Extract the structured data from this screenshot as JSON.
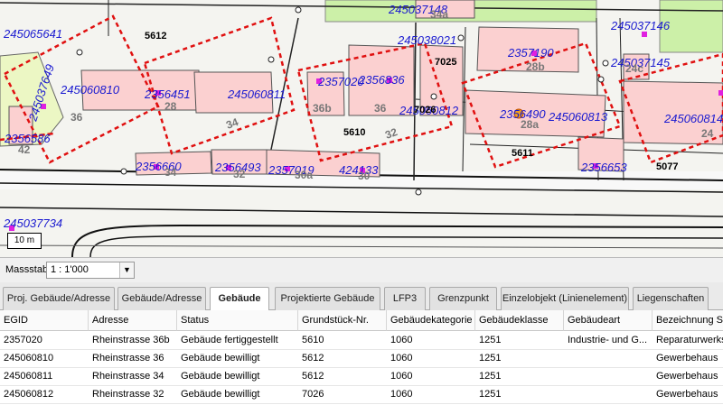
{
  "map": {
    "parcel_numbers": [
      "5612",
      "7025",
      "7026",
      "5610",
      "5611",
      "5077"
    ],
    "building_ids": [
      "245065641",
      "245037148",
      "245037146",
      "245038021",
      "2357190",
      "245037145",
      "245037649",
      "245060810",
      "2356451",
      "245060811",
      "2357020",
      "2356836",
      "245060812",
      "2356490",
      "245060813",
      "245060814",
      "2356586",
      "2356660",
      "2356493",
      "2357019",
      "424133",
      "2356653",
      "245037734"
    ],
    "house_numbers": [
      "34a",
      "28b",
      "24c",
      "36",
      "28",
      "34",
      "36b",
      "36",
      "32",
      "28a",
      "42",
      "34",
      "32",
      "30a",
      "30",
      "24"
    ],
    "scale_bar": "10 m"
  },
  "massstab": {
    "label": "Massstab",
    "value": "1 : 1'000"
  },
  "tabs": [
    {
      "label": "Proj. Gebäude/Adresse",
      "active": false
    },
    {
      "label": "Gebäude/Adresse",
      "active": false
    },
    {
      "label": "Gebäude",
      "active": true
    },
    {
      "label": "Projektierte Gebäude",
      "active": false
    },
    {
      "label": "LFP3",
      "active": false
    },
    {
      "label": "Grenzpunkt",
      "active": false
    },
    {
      "label": "Einzelobjekt (Linienelement)",
      "active": false
    },
    {
      "label": "Liegenschaften",
      "active": false
    }
  ],
  "table": {
    "headers": [
      "EGID",
      "Adresse",
      "Status",
      "Grundstück-Nr.",
      "Gebäudekategorie",
      "Gebäudeklasse",
      "Gebäudeart",
      "Bezeichnung St"
    ],
    "rows": [
      [
        "2357020",
        "Rheinstrasse 36b",
        "Gebäude fertiggestellt",
        "5610",
        "1060",
        "1251",
        "Industrie- und G...",
        "Reparaturwerks"
      ],
      [
        "245060810",
        "Rheinstrasse 36",
        "Gebäude bewilligt",
        "5612",
        "1060",
        "1251",
        "",
        "Gewerbehaus"
      ],
      [
        "245060811",
        "Rheinstrasse 34",
        "Gebäude bewilligt",
        "5612",
        "1060",
        "1251",
        "",
        "Gewerbehaus"
      ],
      [
        "245060812",
        "Rheinstrasse 32",
        "Gebäude bewilligt",
        "7026",
        "1060",
        "1251",
        "",
        "Gewerbehaus"
      ]
    ]
  }
}
